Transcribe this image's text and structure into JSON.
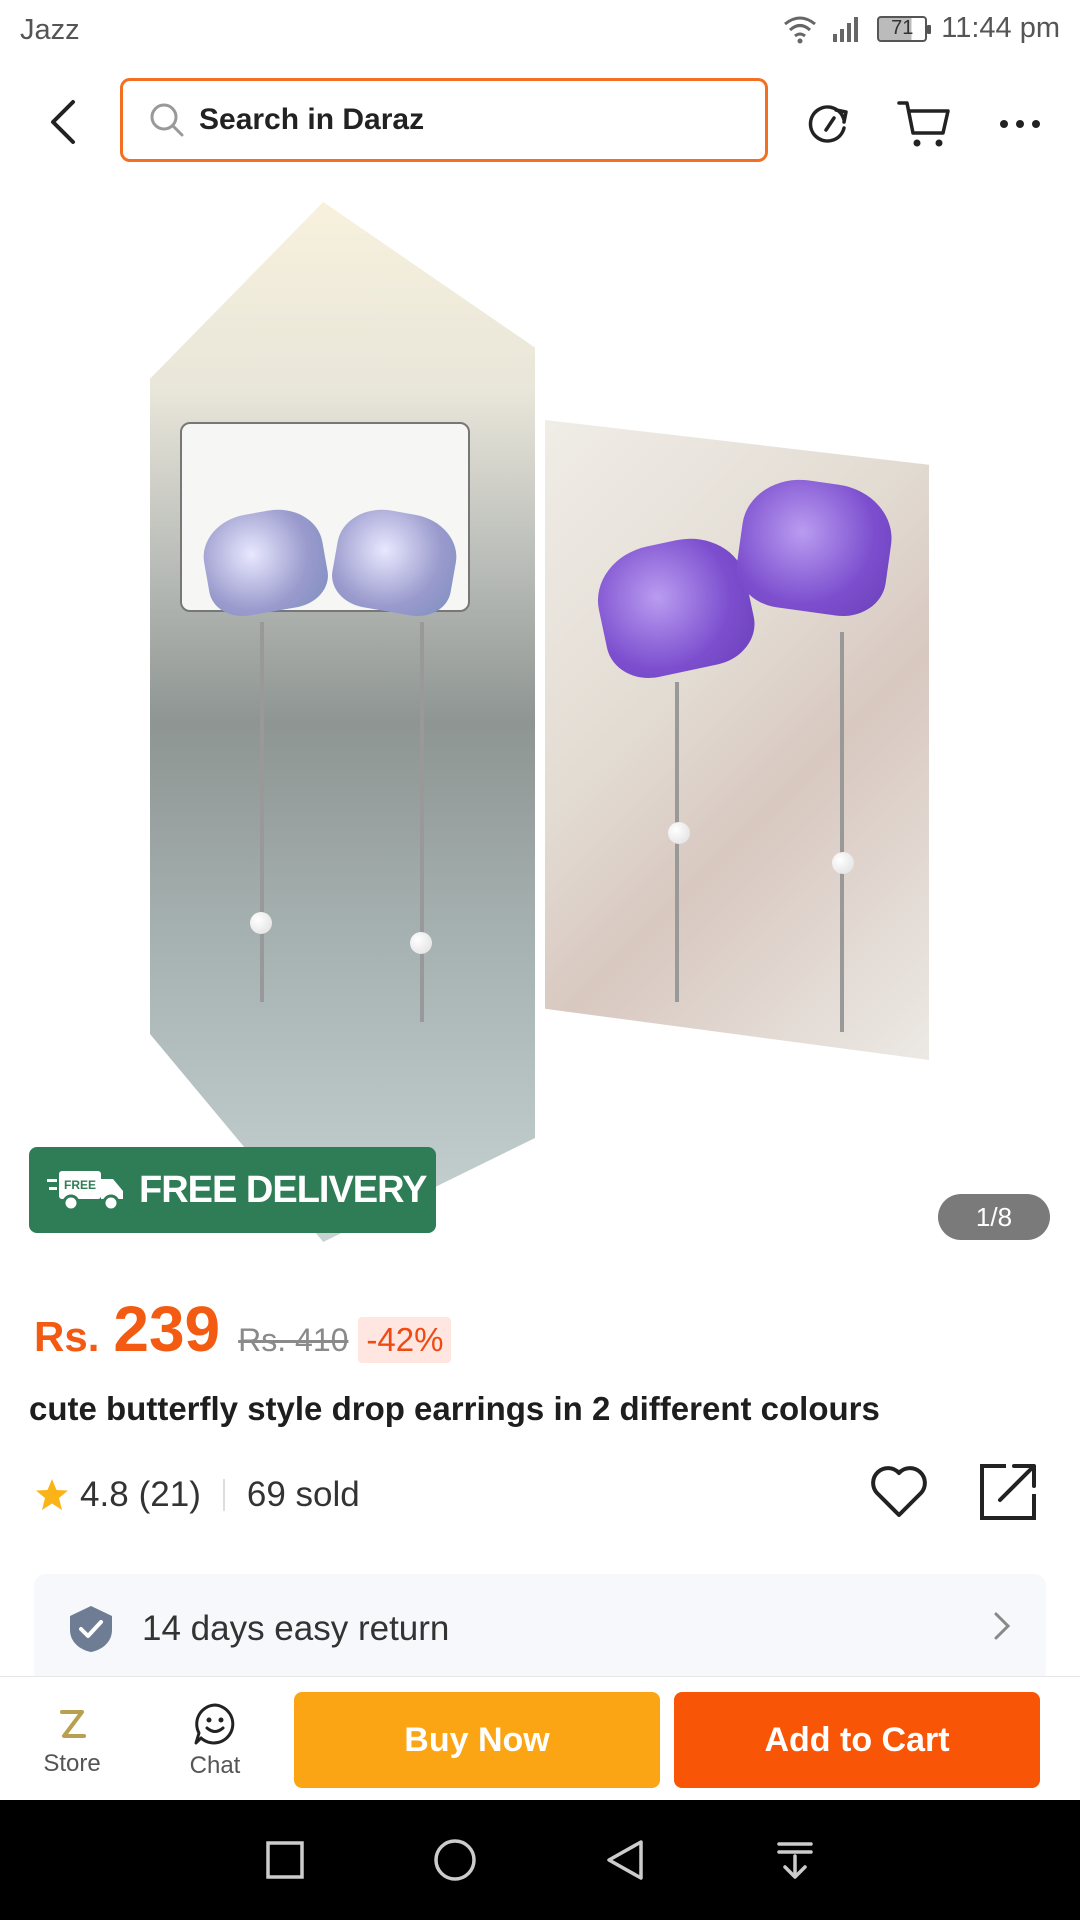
{
  "status_bar": {
    "carrier": "Jazz",
    "battery": "71",
    "time": "11:44 pm"
  },
  "header": {
    "search_placeholder": "Search in Daraz"
  },
  "gallery": {
    "badge": "FREE DELIVERY",
    "badge_icon_text": "FREE",
    "counter": "1/8"
  },
  "product": {
    "currency": "Rs.",
    "price": "239",
    "original_price": "Rs. 410",
    "discount": "-42%",
    "title": "cute butterfly style drop earrings in 2 different colours",
    "rating": "4.8",
    "review_count": "(21)",
    "sold": "69 sold"
  },
  "return_policy": {
    "text": "14 days easy return"
  },
  "action_bar": {
    "store_label": "Store",
    "chat_label": "Chat",
    "buy_now": "Buy Now",
    "add_to_cart": "Add to Cart"
  },
  "colors": {
    "accent": "#f85606",
    "buy_now": "#fba515",
    "free_delivery": "#2e7d57"
  }
}
